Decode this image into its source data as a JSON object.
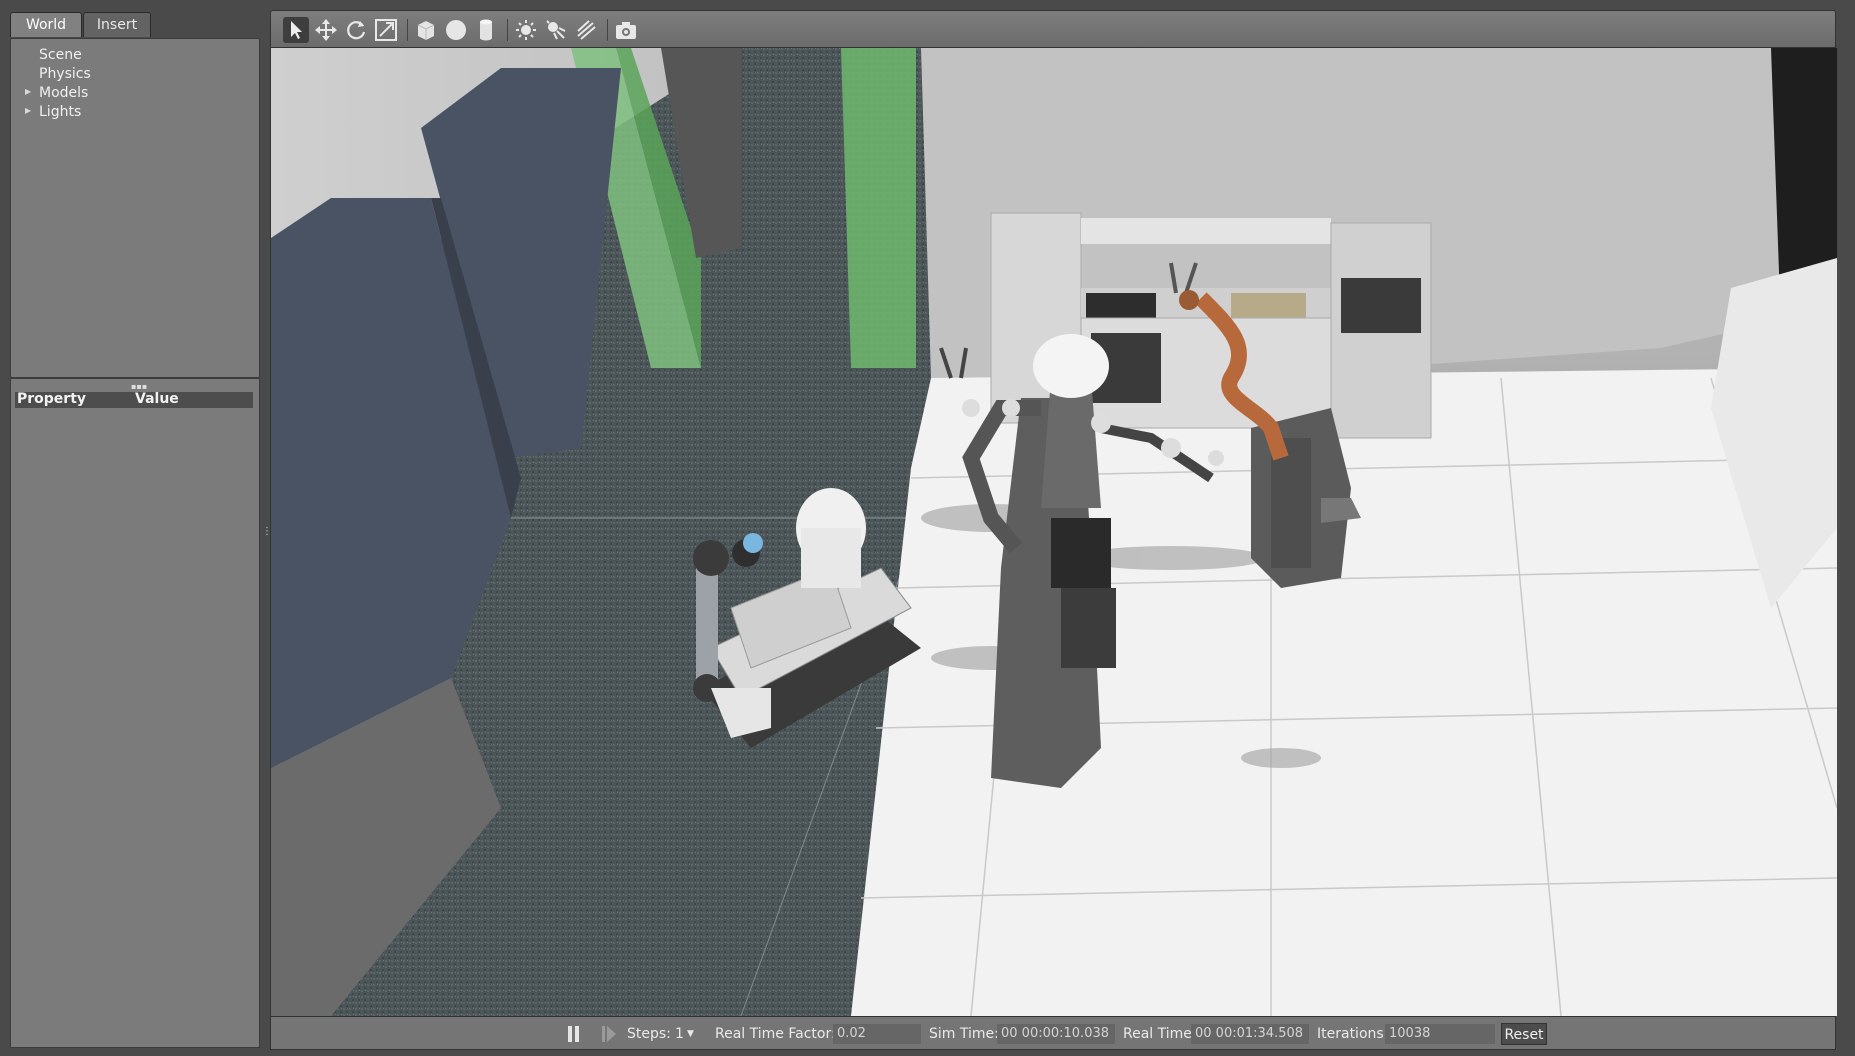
{
  "left_panel": {
    "tabs": [
      "World",
      "Insert"
    ],
    "tree": [
      {
        "label": "Scene",
        "expandable": false
      },
      {
        "label": "Physics",
        "expandable": false
      },
      {
        "label": "Models",
        "expandable": true
      },
      {
        "label": "Lights",
        "expandable": true
      }
    ],
    "property_header": {
      "property": "Property",
      "value": "Value"
    }
  },
  "toolbar": {
    "tools": [
      "select-arrow-icon",
      "translate-icon",
      "rotate-icon",
      "scale-icon",
      "box-icon",
      "sphere-icon",
      "cylinder-icon",
      "point-light-icon",
      "spot-light-icon",
      "directional-light-icon",
      "screenshot-icon"
    ],
    "active_tool": "select-arrow-icon"
  },
  "statusbar": {
    "steps_label": "Steps:",
    "steps_value": "1",
    "rtf_label": "Real Time Factor:",
    "rtf_value": "0.02",
    "sim_time_label": "Sim Time:",
    "sim_time_value": "00 00:00:10.038",
    "real_time_label": "Real Time:",
    "real_time_value": "00 00:01:34.508",
    "iterations_label": "Iterations:",
    "iterations_value": "10038",
    "reset_label": "Reset"
  }
}
